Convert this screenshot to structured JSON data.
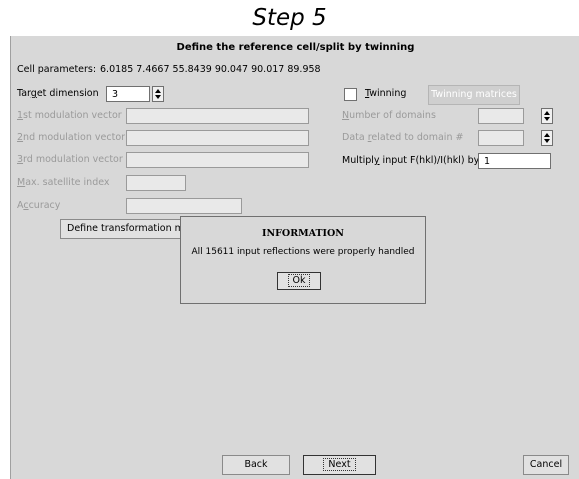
{
  "caption": "Step 5",
  "window": {
    "title": "Define the reference cell/split by twinning",
    "cell_parameters_label": "Cell parameters:",
    "cell_parameters_value": "6.0185 7.4667 55.8439 90.047 90.017 89.958",
    "target_dimension_label": "Target dimension",
    "target_dimension_value": "3",
    "mod_vector_1_label": "1st modulation vector",
    "mod_vector_2_label": "2nd modulation vector",
    "mod_vector_3_label": "3rd modulation vector",
    "max_satellite_label": "Max. satellite index",
    "accuracy_label": "Accuracy",
    "define_transformation_label": "Define transformation ma",
    "twinning_label": "Twinning",
    "twinning_checked": false,
    "twinning_matrices_label": "Twinning matrices",
    "number_of_domains_label": "Number of domains",
    "data_related_label": "Data related to domain #",
    "multiply_label": "Multiply input F(hkl)/I(hkl) by",
    "multiply_value": "1",
    "back_label": "Back",
    "next_label": "Next",
    "cancel_label": "Cancel"
  },
  "dialog": {
    "title": "INFORMATION",
    "message": "All 15611 input reflections were properly handled",
    "ok_label": "Ok"
  }
}
